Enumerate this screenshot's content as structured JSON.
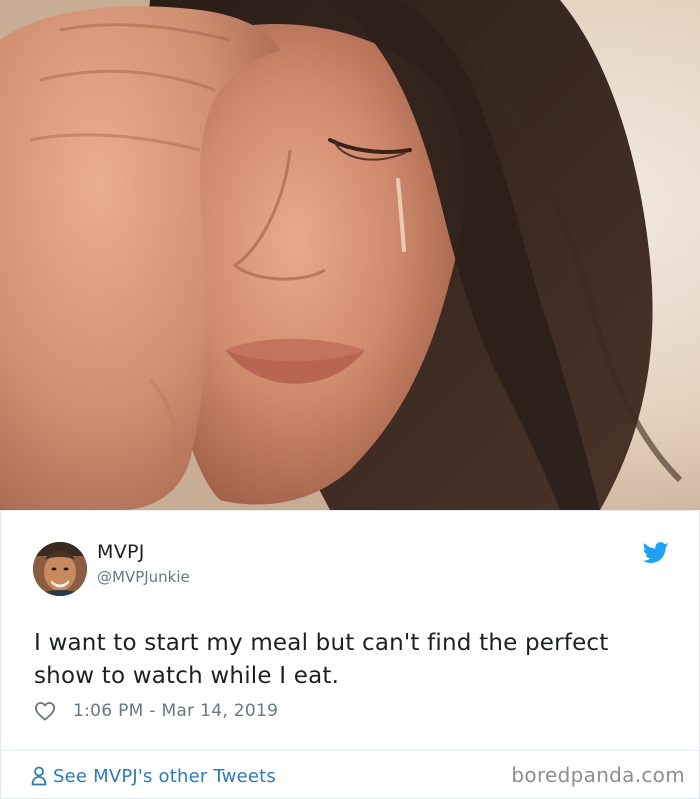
{
  "photo": {
    "subject": "crying-woman-photo"
  },
  "tweet": {
    "display_name": "MVPJ",
    "handle": "@MVPJunkie",
    "text": "I want to start my meal but can't find the perfect show to watch while I eat.",
    "timestamp": "1:06 PM - Mar 14, 2019",
    "see_more_label": "See MVPJ's other Tweets",
    "watermark": "boredpanda.com"
  },
  "colors": {
    "twitter_blue": "#1da1f2",
    "link_blue": "#2b7bb9",
    "text_primary": "#1c2022",
    "text_secondary": "#697882",
    "watermark_gray": "#8e8e8e"
  },
  "icons": {
    "brand": "twitter-bird-icon",
    "like": "heart-outline-icon",
    "profile": "person-outline-icon"
  }
}
